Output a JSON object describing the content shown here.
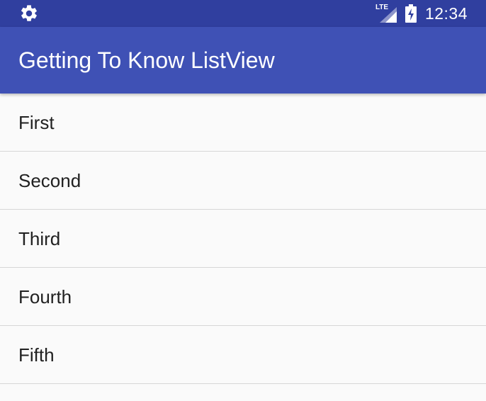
{
  "status_bar": {
    "network_label": "LTE",
    "time": "12:34",
    "icons": [
      "gear-icon",
      "lte-signal-icon",
      "battery-charging-icon"
    ]
  },
  "app_bar": {
    "title": "Getting To Know ListView"
  },
  "list": {
    "items": [
      {
        "label": "First"
      },
      {
        "label": "Second"
      },
      {
        "label": "Third"
      },
      {
        "label": "Fourth"
      },
      {
        "label": "Fifth"
      }
    ]
  },
  "colors": {
    "status_bar": "#303f9f",
    "app_bar": "#3f51b5",
    "background": "#fafafa",
    "divider": "#d6d6d6",
    "item_text": "#212121"
  }
}
